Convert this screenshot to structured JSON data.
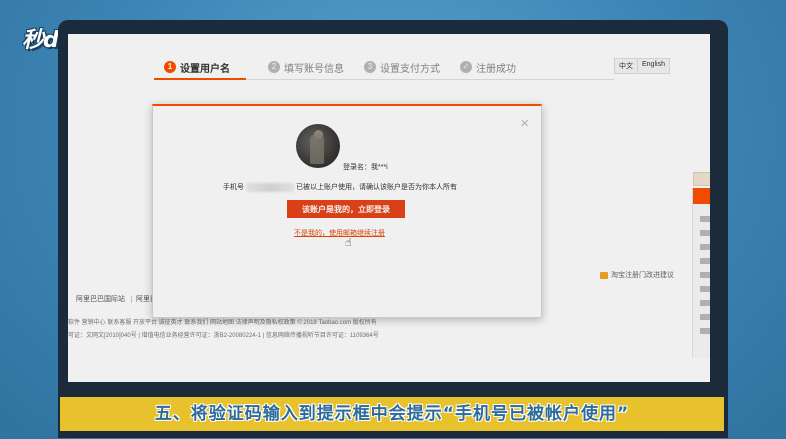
{
  "watermark": {
    "logo_text": "秒dong视频"
  },
  "steps": [
    {
      "number": "1",
      "label": "设置用户名",
      "active": true
    },
    {
      "number": "2",
      "label": "填写账号信息",
      "active": false
    },
    {
      "number": "3",
      "label": "设置支付方式",
      "active": false
    },
    {
      "number": "✓",
      "label": "注册成功",
      "active": false
    }
  ],
  "language": {
    "chinese": "中文",
    "english": "English"
  },
  "modal": {
    "close": "×",
    "account_name": "登录名：我***i",
    "phone_prefix": "手机号",
    "phone_message": "已被以上账户使用，请确认该账户是否为你本人所有",
    "login_button": "该账户是我的，立即登录",
    "not_mine_link": "不是我的，使用邮箱继续注册"
  },
  "page": {
    "feedback": "淘宝注册门改进建议",
    "footer_links": [
      "阿里巴巴国际站",
      "阿里巴巴"
    ],
    "footer_row1": "软件  营销中心  联系客服  开放平台  诚征英才  联系我们  网站地图  法律声明及隐私权政策         © 2018 Taobao.com 版权所有",
    "footer_row2": "可证：文网文[2010]040号  |  增值电信业务经营许可证：浙B2-20080224-1  |  信息网络传播视听节目许可证：1109364号"
  },
  "subtitle": "五、将验证码输入到提示框中会提示“手机号已被帐户使用”"
}
